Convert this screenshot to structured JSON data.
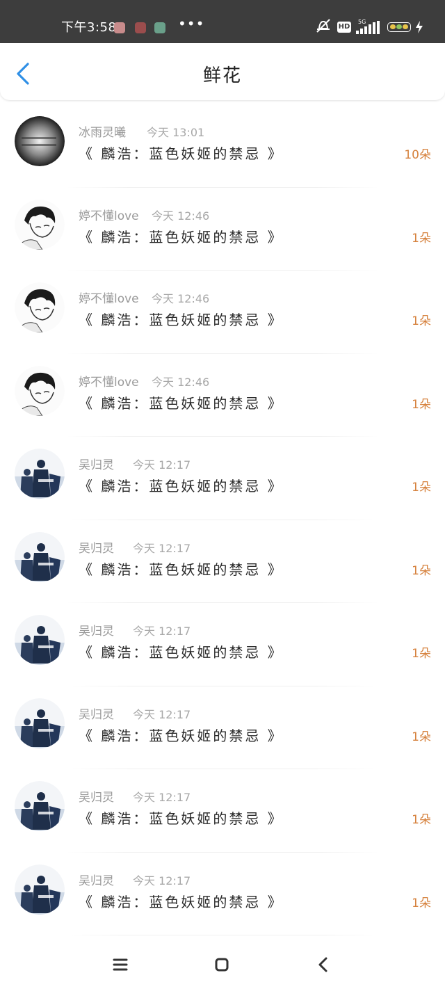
{
  "status_bar": {
    "time": "下午3:58",
    "more": "•••",
    "network": "5G",
    "hd": "HD"
  },
  "header": {
    "title": "鲜花"
  },
  "items": [
    {
      "user": "冰雨灵曦",
      "time": "今天 13:01",
      "book": "《 麟浩：蓝色妖姬的禁忌 》",
      "count": "10朵",
      "avatar": "dark-text"
    },
    {
      "user": "婷不懂love",
      "time": "今天 12:46",
      "book": "《 麟浩：蓝色妖姬的禁忌 》",
      "count": "1朵",
      "avatar": "anime"
    },
    {
      "user": "婷不懂love",
      "time": "今天 12:46",
      "book": "《 麟浩：蓝色妖姬的禁忌 》",
      "count": "1朵",
      "avatar": "anime"
    },
    {
      "user": "婷不懂love",
      "time": "今天 12:46",
      "book": "《 麟浩：蓝色妖姬的禁忌 》",
      "count": "1朵",
      "avatar": "anime"
    },
    {
      "user": "吴归灵",
      "time": "今天 12:17",
      "book": "《 麟浩：蓝色妖姬的禁忌 》",
      "count": "1朵",
      "avatar": "silhouette"
    },
    {
      "user": "吴归灵",
      "time": "今天 12:17",
      "book": "《 麟浩：蓝色妖姬的禁忌 》",
      "count": "1朵",
      "avatar": "silhouette"
    },
    {
      "user": "吴归灵",
      "time": "今天 12:17",
      "book": "《 麟浩：蓝色妖姬的禁忌 》",
      "count": "1朵",
      "avatar": "silhouette"
    },
    {
      "user": "吴归灵",
      "time": "今天 12:17",
      "book": "《 麟浩：蓝色妖姬的禁忌 》",
      "count": "1朵",
      "avatar": "silhouette"
    },
    {
      "user": "吴归灵",
      "time": "今天 12:17",
      "book": "《 麟浩：蓝色妖姬的禁忌 》",
      "count": "1朵",
      "avatar": "silhouette"
    },
    {
      "user": "吴归灵",
      "time": "今天 12:17",
      "book": "《 麟浩：蓝色妖姬的禁忌 》",
      "count": "1朵",
      "avatar": "silhouette"
    }
  ],
  "colors": {
    "accent": "#2f8fe6",
    "count": "#d6823e",
    "status_bar": "#3d3d3d"
  },
  "icons": {
    "back": "chevron-left-icon",
    "nav_menu": "menu-icon",
    "nav_home": "home-square-icon",
    "nav_back": "back-chevron-icon"
  }
}
